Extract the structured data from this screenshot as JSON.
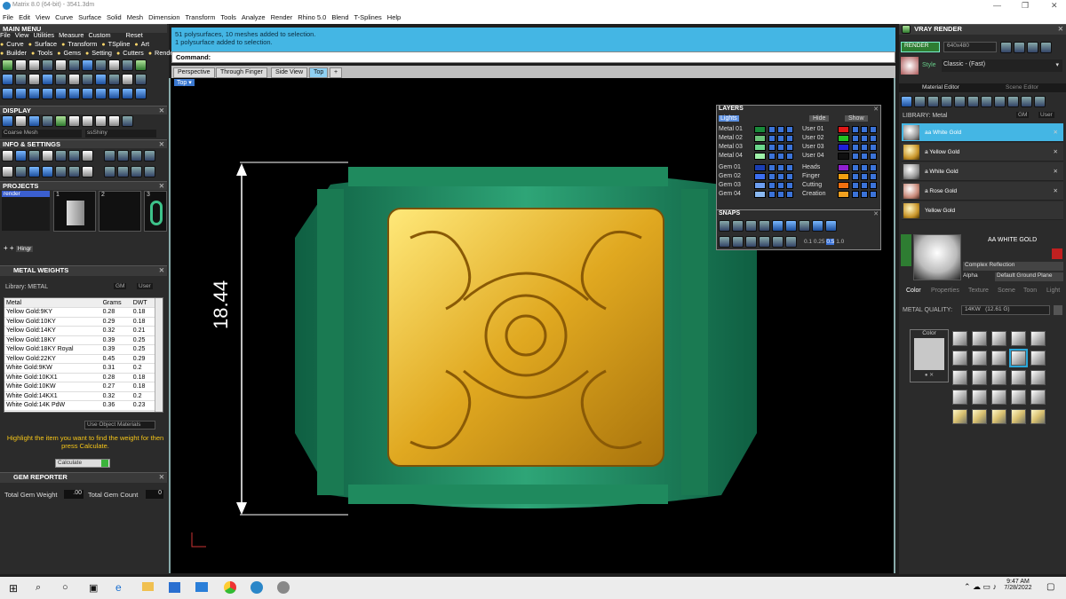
{
  "window": {
    "title": "Matrix 8.0 (64-bit) - 3541.3dm"
  },
  "menubar": [
    "File",
    "Edit",
    "View",
    "Curve",
    "Surface",
    "Solid",
    "Mesh",
    "Dimension",
    "Transform",
    "Tools",
    "Analyze",
    "Render",
    "Rhino 5.0",
    "Blend",
    "T-Splines",
    "Help"
  ],
  "left": {
    "main_menu_title": "MAIN MENU",
    "main_menu_row1": [
      "File",
      "View",
      "Utilities",
      "Measure",
      "Custom",
      "Reset"
    ],
    "main_menu_row2": [
      "Curve",
      "Surface",
      "Transform",
      "TSpline",
      "Art"
    ],
    "main_menu_row3": [
      "Builder",
      "Tools",
      "Gems",
      "Setting",
      "Cutters",
      "Render"
    ],
    "display_title": "DISPLAY",
    "display_left_value": "Coarse Mesh",
    "display_right_value": "ssShiny",
    "info_title": "INFO & SETTINGS",
    "projects_title": "PROJECTS",
    "projects_item": "render",
    "project_slots": [
      "1",
      "2",
      "3"
    ],
    "hinge_label": "Hingr",
    "metal_weights_title": "METAL WEIGHTS",
    "library_label": "Library: METAL",
    "library_units": [
      "GM",
      "User"
    ],
    "metal_columns": [
      "Metal",
      "Grams",
      "DWT"
    ],
    "metal_rows": [
      [
        "Yellow Gold:9KY",
        "0.28",
        "0.18"
      ],
      [
        "Yellow Gold:10KY",
        "0.29",
        "0.18"
      ],
      [
        "Yellow Gold:14KY",
        "0.32",
        "0.21"
      ],
      [
        "Yellow Gold:18KY",
        "0.39",
        "0.25"
      ],
      [
        "Yellow Gold:18KY Royal",
        "0.39",
        "0.25"
      ],
      [
        "Yellow Gold:22KY",
        "0.45",
        "0.29"
      ],
      [
        "White Gold:9KW",
        "0.31",
        "0.2"
      ],
      [
        "White Gold:10KX1",
        "0.28",
        "0.18"
      ],
      [
        "White Gold:10KW",
        "0.27",
        "0.18"
      ],
      [
        "White Gold:14KX1",
        "0.32",
        "0.2"
      ],
      [
        "White Gold:14K PdW",
        "0.36",
        "0.23"
      ]
    ],
    "use_object_materials": "Use Object Materials",
    "hint": "Highlight the item you want to find the weight for then press Calculate.",
    "calculate_label": "Calculate",
    "gem_reporter_title": "GEM REPORTER",
    "total_gem_weight_label": "Total Gem Weight",
    "total_gem_weight_value": ".00",
    "total_gem_count_label": "Total Gem Count",
    "total_gem_count_value": "0"
  },
  "command": {
    "history": [
      "51 polysurfaces, 10 meshes added to selection.",
      "1 polysurface added to selection."
    ],
    "prompt_label": "Command:"
  },
  "viewtabs": [
    "Perspective",
    "Through Finger",
    "Side View",
    "Top"
  ],
  "viewport": {
    "name": "Top",
    "dimension": "18.44"
  },
  "layers": {
    "title": "LAYERS",
    "lights_label": "Lights",
    "hide_label": "Hide",
    "show_label": "Show",
    "left_col": [
      "Metal 01",
      "Metal 02",
      "Metal 03",
      "Metal 04",
      "Gem 01",
      "Gem 02",
      "Gem 03",
      "Gem 04"
    ],
    "right_col": [
      "User 01",
      "User 02",
      "User 03",
      "User 04",
      "Heads",
      "Finger",
      "Cutting",
      "Creation"
    ],
    "left_colors": [
      "#1a8a3a",
      "#6cc47a",
      "#6cd88c",
      "#9ef0a8",
      "#1b3fb3",
      "#3c6ef0",
      "#6c9ef0",
      "#8ab8f0"
    ],
    "right_colors": [
      "#e01818",
      "#22c022",
      "#2020d8",
      "#101010",
      "#9020d0",
      "#f0a010",
      "#f07010",
      "#f0a020"
    ]
  },
  "snaps": {
    "title": "SNAPS",
    "values": [
      "0.1",
      "0.25",
      "0.5",
      "1.0"
    ]
  },
  "vray": {
    "title": "VRAY RENDER",
    "render_label": "RENDER",
    "resolution": "640x480",
    "style_label": "Style",
    "style_value": "Classic - (Fast)",
    "tabs": [
      "Material Editor",
      "Scene Editor"
    ],
    "library_label": "LIBRARY: Metal",
    "library_units": [
      "GM",
      "User"
    ],
    "materials": [
      "aa White Gold",
      "a Yellow Gold",
      "a White Gold",
      "a Rose Gold",
      "Yellow Gold"
    ],
    "selected_material": "AA WHITE GOLD",
    "reflection": "Complex Reflection",
    "alpha_label": "Alpha",
    "ground_plane": "Default Ground Plane",
    "lower_tabs": [
      "Color",
      "Properties",
      "Texture",
      "Scene",
      "Toon",
      "Light"
    ],
    "metal_quality_label": "METAL QUALITY:",
    "metal_quality_value": "14KW",
    "metal_quality_extra": "(12.61 G)",
    "color_label": "Color"
  },
  "taskbar": {
    "time": "9:47 AM",
    "date": "7/28/2022"
  }
}
